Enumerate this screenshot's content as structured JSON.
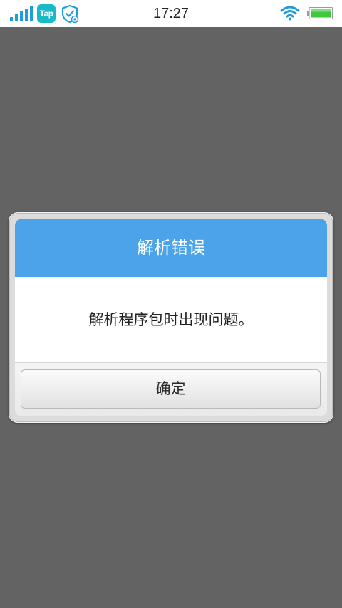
{
  "status_bar": {
    "time": "17:27",
    "app_badge": "Tap",
    "battery_color": "#3fc73f",
    "icons": [
      "signal-icon",
      "tap-icon",
      "shield-icon",
      "wifi-icon",
      "battery-icon"
    ]
  },
  "dialog": {
    "title": "解析错误",
    "message": "解析程序包时出现问题。",
    "confirm_label": "确定",
    "header_color": "#4ba3ea"
  }
}
